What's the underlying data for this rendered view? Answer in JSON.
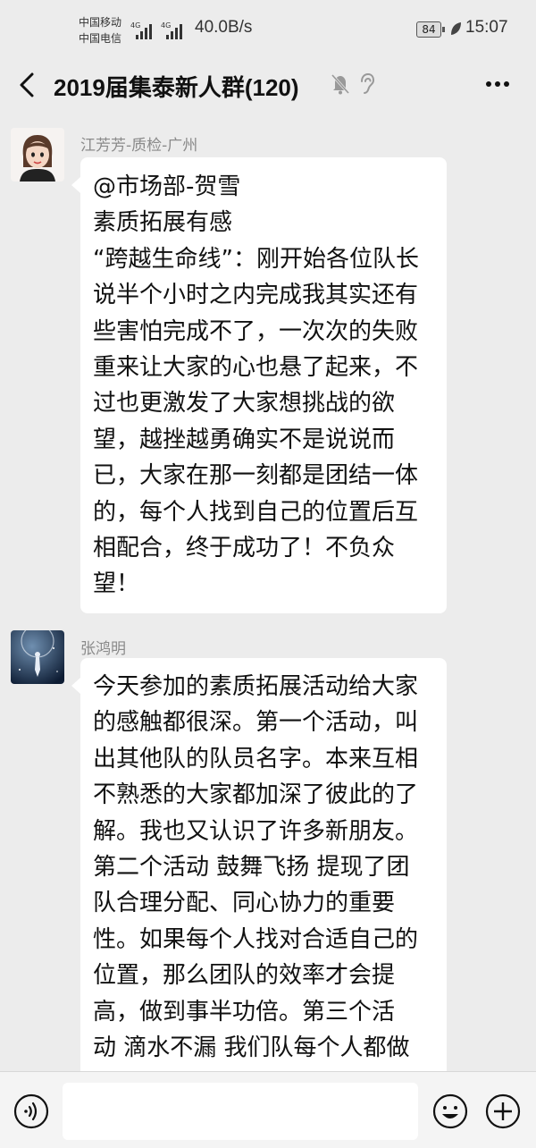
{
  "status_bar": {
    "carrier_1": "中国移动",
    "carrier_2": "中国电信",
    "network_1": "4G",
    "network_2": "4G",
    "net_speed": "40.0B/s",
    "battery": "84",
    "time": "15:07"
  },
  "header": {
    "title": "2019届集泰新人群(120)",
    "back_icon": "chevron-left-icon",
    "mute_icon": "bell-off-icon",
    "ear_icon": "ear-icon",
    "more_icon": "more-horizontal-icon"
  },
  "messages": [
    {
      "sender": "江芳芳-质检-广州",
      "lines": [
        "@市场部-贺雪",
        "素质拓展有感",
        "“跨越生命线”：刚开始各位队长",
        "说半个小时之内完成我其实还有",
        "些害怕完成不了，一次次的失败",
        "重来让大家的心也悬了起来，不",
        "过也更激发了大家想挑战的欲",
        "望，越挫越勇确实不是说说而",
        "已，大家在那一刻都是团结一体",
        "的，每个人找到自己的位置后互",
        "相配合，终于成功了！不负众",
        "望！"
      ]
    },
    {
      "sender": "张鸿明",
      "lines": [
        "今天参加的素质拓展活动给大家",
        "的感触都很深。第一个活动，叫",
        "出其他队的队员名字。本来互相",
        "不熟悉的大家都加深了彼此的了",
        "解。我也又认识了许多新朋友。",
        "第二个活动 鼓舞飞扬 提现了团",
        "队合理分配、同心协力的重要",
        "性。如果每个人找对合适自己的",
        "位置，那么团队的效率才会提",
        "高，做到事半功倍。第三个活",
        "动 滴水不漏 我们队每个人都做"
      ]
    }
  ],
  "input_bar": {
    "text_value": "",
    "voice_icon": "voice-icon",
    "emoji_icon": "emoji-icon",
    "plus_icon": "plus-circle-icon"
  }
}
